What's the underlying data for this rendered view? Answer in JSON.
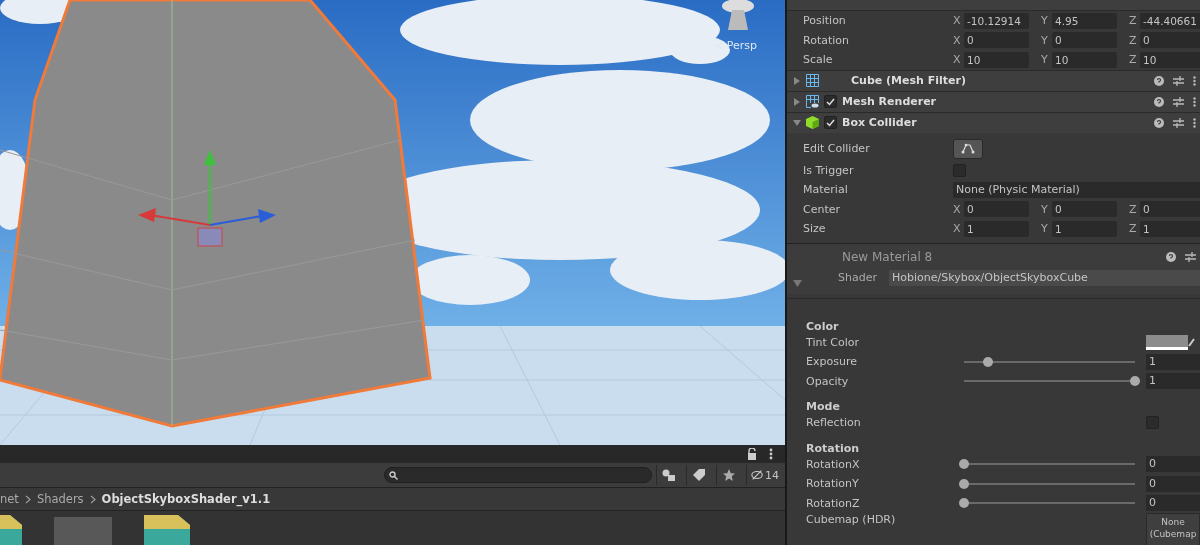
{
  "scene": {
    "view_label": "< Persp"
  },
  "project": {
    "hidden_count": "14",
    "breadcrumb": [
      {
        "label": "net",
        "selected": false
      },
      {
        "label": "Shaders",
        "selected": false
      },
      {
        "label": "ObjectSkyboxShader_v1.1",
        "selected": true
      }
    ],
    "assets": [
      {
        "kind": "shader"
      },
      {
        "kind": "blank"
      },
      {
        "kind": "shader"
      }
    ]
  },
  "inspector": {
    "transform": [
      {
        "label": "Position",
        "fields": [
          {
            "axis": "X",
            "value": "-10.12914"
          },
          {
            "axis": "Y",
            "value": "4.95"
          },
          {
            "axis": "Z",
            "value": "-44.40661"
          }
        ]
      },
      {
        "label": "Rotation",
        "fields": [
          {
            "axis": "X",
            "value": "0"
          },
          {
            "axis": "Y",
            "value": "0"
          },
          {
            "axis": "Z",
            "value": "0"
          }
        ]
      },
      {
        "label": "Scale",
        "fields": [
          {
            "axis": "X",
            "value": "10"
          },
          {
            "axis": "Y",
            "value": "10"
          },
          {
            "axis": "Z",
            "value": "10"
          }
        ]
      }
    ],
    "components": [
      {
        "kind": "filter",
        "name": "Cube (Mesh Filter)",
        "expanded": false
      },
      {
        "kind": "renderer",
        "name": "Mesh Renderer",
        "expanded": false,
        "checked": true
      },
      {
        "kind": "collider",
        "name": "Box Collider",
        "expanded": true,
        "checked": true
      }
    ],
    "collider": [
      {
        "kind": "button",
        "label": "Edit Collider"
      },
      {
        "kind": "checkbox",
        "label": "Is Trigger",
        "checked": false
      },
      {
        "kind": "object",
        "label": "Material",
        "value": "None (Physic Material)"
      },
      {
        "kind": "vector",
        "label": "Center",
        "fields": [
          {
            "axis": "X",
            "value": "0"
          },
          {
            "axis": "Y",
            "value": "0"
          },
          {
            "axis": "Z",
            "value": "0"
          }
        ]
      },
      {
        "kind": "vector",
        "label": "Size",
        "fields": [
          {
            "axis": "X",
            "value": "1"
          },
          {
            "axis": "Y",
            "value": "1"
          },
          {
            "axis": "Z",
            "value": "1"
          }
        ]
      }
    ],
    "material": {
      "name": "New Material 8",
      "shader_label": "Shader",
      "shader": "Hobione/Skybox/ObjectSkyboxCube",
      "expanded": true,
      "sections": [
        {
          "heading": "Color",
          "props": [
            {
              "kind": "color",
              "label": "Tint Color",
              "color": "#8c8c8c"
            },
            {
              "kind": "slider",
              "label": "Exposure",
              "level": 0.14,
              "value": "1"
            },
            {
              "kind": "slider",
              "label": "Opacity",
              "level": 1,
              "value": "1"
            }
          ]
        },
        {
          "heading": "Mode",
          "props": [
            {
              "kind": "checkbox",
              "label": "Reflection",
              "checked": false
            }
          ]
        },
        {
          "heading": "Rotation",
          "props": [
            {
              "kind": "slider",
              "label": "RotationX",
              "level": 0,
              "value": "0"
            },
            {
              "kind": "slider",
              "label": "RotationY",
              "level": 0,
              "value": "0"
            },
            {
              "kind": "slider",
              "label": "RotationZ",
              "level": 0,
              "value": "0"
            },
            {
              "kind": "texture",
              "label": "Cubemap (HDR)",
              "value": "None (Cubemap"
            }
          ]
        }
      ]
    }
  }
}
